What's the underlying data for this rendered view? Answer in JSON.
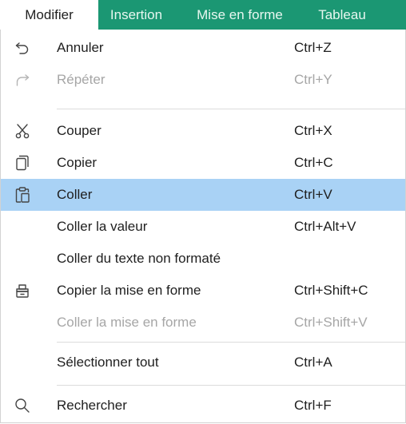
{
  "menubar": {
    "tabs": [
      {
        "label": "Modifier",
        "active": true
      },
      {
        "label": "Insertion",
        "active": false
      },
      {
        "label": "Mise en forme",
        "active": false
      },
      {
        "label": "Tableau",
        "active": false
      }
    ]
  },
  "menu": {
    "undo": {
      "label": "Annuler",
      "shortcut": "Ctrl+Z",
      "icon": "undo-icon"
    },
    "redo": {
      "label": "Répéter",
      "shortcut": "Ctrl+Y",
      "icon": "redo-icon",
      "disabled": true
    },
    "cut": {
      "label": "Couper",
      "shortcut": "Ctrl+X",
      "icon": "scissors-icon"
    },
    "copy": {
      "label": "Copier",
      "shortcut": "Ctrl+C",
      "icon": "copy-icon"
    },
    "paste": {
      "label": "Coller",
      "shortcut": "Ctrl+V",
      "icon": "paste-icon",
      "highlighted": true
    },
    "paste_value": {
      "label": "Coller la valeur",
      "shortcut": "Ctrl+Alt+V"
    },
    "paste_plain": {
      "label": "Coller du texte non formaté"
    },
    "copy_format": {
      "label": "Copier la mise en forme",
      "shortcut": "Ctrl+Shift+C",
      "icon": "format-painter-icon"
    },
    "paste_format": {
      "label": "Coller la mise en forme",
      "shortcut": "Ctrl+Shift+V",
      "disabled": true
    },
    "select_all": {
      "label": "Sélectionner tout",
      "shortcut": "Ctrl+A"
    },
    "find": {
      "label": "Rechercher",
      "shortcut": "Ctrl+F",
      "icon": "search-icon"
    }
  },
  "colors": {
    "menubar_bg": "#1b9773",
    "menubar_text": "#e8f7f0",
    "highlight": "#a9d2f5",
    "disabled_text": "#a6a6a6"
  }
}
